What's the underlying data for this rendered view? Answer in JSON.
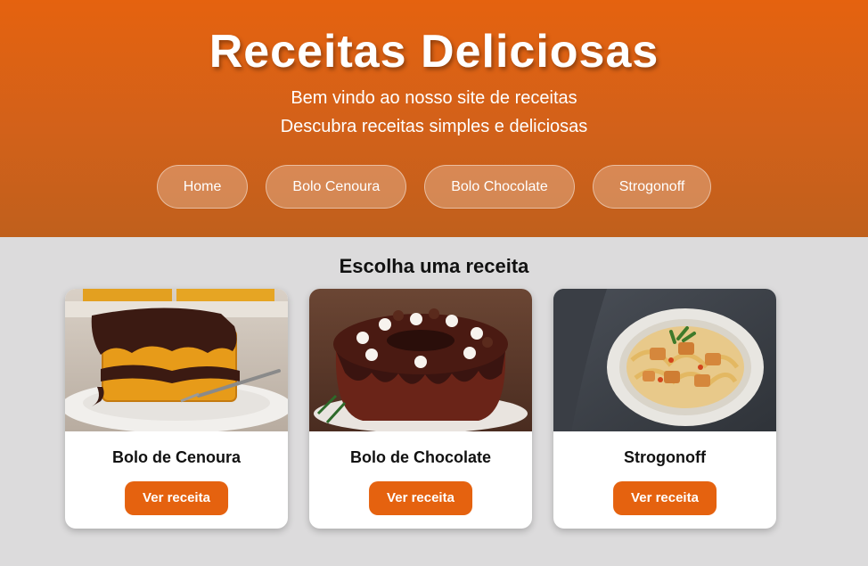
{
  "header": {
    "title": "Receitas Deliciosas",
    "subtitle_1": "Bem vindo ao nosso site de receitas",
    "subtitle_2": "Descubra receitas simples e deliciosas"
  },
  "nav": [
    {
      "label": "Home"
    },
    {
      "label": "Bolo Cenoura"
    },
    {
      "label": "Bolo Chocolate"
    },
    {
      "label": "Strogonoff"
    }
  ],
  "main": {
    "section_title": "Escolha uma receita",
    "cards": [
      {
        "title": "Bolo de Cenoura",
        "button": "Ver receita",
        "image": "carrot-cake-with-chocolate-photo"
      },
      {
        "title": "Bolo de Chocolate",
        "button": "Ver receita",
        "image": "chocolate-bundt-cake-photo"
      },
      {
        "title": "Strogonoff",
        "button": "Ver receita",
        "image": "strogonoff-with-pasta-photo"
      }
    ]
  },
  "colors": {
    "accent": "#e5620f",
    "background": "#dcdbdc",
    "card_background": "#ffffff"
  }
}
